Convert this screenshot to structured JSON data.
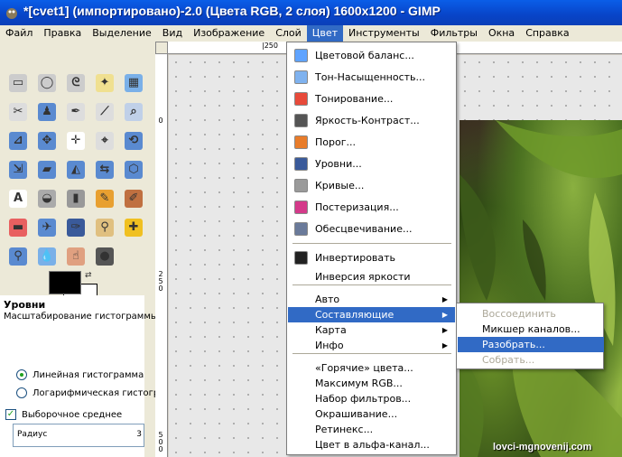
{
  "window": {
    "title": "*[cvet1] (импортировано)-2.0 (Цвета RGB, 2 слоя) 1600x1200 - GIMP"
  },
  "menubar": [
    {
      "label": "Файл",
      "active": false
    },
    {
      "label": "Правка",
      "active": false
    },
    {
      "label": "Выделение",
      "active": false
    },
    {
      "label": "Вид",
      "active": false
    },
    {
      "label": "Изображение",
      "active": false
    },
    {
      "label": "Слой",
      "active": false
    },
    {
      "label": "Цвет",
      "active": true
    },
    {
      "label": "Инструменты",
      "active": false
    },
    {
      "label": "Фильтры",
      "active": false
    },
    {
      "label": "Окна",
      "active": false
    },
    {
      "label": "Справка",
      "active": false
    }
  ],
  "color_menu": {
    "items": [
      {
        "label": "Цветовой баланс...",
        "icon": "color-balance-icon",
        "icon_color": "#5fa3ff"
      },
      {
        "label": "Тон-Насыщенность...",
        "icon": "hue-saturation-icon",
        "icon_color": "#7fb2ef"
      },
      {
        "label": "Тонирование...",
        "icon": "colorize-icon",
        "icon_color": "#e84a3a"
      },
      {
        "label": "Яркость-Контраст...",
        "icon": "brightness-contrast-icon",
        "icon_color": "#555555"
      },
      {
        "label": "Порог...",
        "icon": "threshold-icon",
        "icon_color": "#e87c2a"
      },
      {
        "label": "Уровни...",
        "icon": "levels-icon",
        "icon_color": "#3a5a9a"
      },
      {
        "label": "Кривые...",
        "icon": "curves-icon",
        "icon_color": "#9a9a9a"
      },
      {
        "label": "Постеризация...",
        "icon": "posterize-icon",
        "icon_color": "#d43a8a"
      },
      {
        "label": "Обесцвечивание...",
        "icon": "desaturate-icon",
        "icon_color": "#6a7a9a"
      },
      {
        "label": "Инвертировать",
        "icon": "invert-icon",
        "icon_color": "#222222"
      },
      {
        "label": "Инверсия яркости",
        "icon": "",
        "icon_color": ""
      },
      {
        "label": "Авто",
        "submenu": true
      },
      {
        "label": "Составляющие",
        "submenu": true,
        "highlighted": true
      },
      {
        "label": "Карта",
        "submenu": true
      },
      {
        "label": "Инфо",
        "submenu": true
      },
      {
        "label": "«Горячие» цвета..."
      },
      {
        "label": "Максимум RGB..."
      },
      {
        "label": "Набор фильтров..."
      },
      {
        "label": "Окрашивание..."
      },
      {
        "label": "Ретинекс..."
      },
      {
        "label": "Цвет в альфа-канал..."
      }
    ]
  },
  "components_submenu": {
    "items": [
      {
        "label": "Воссоединить",
        "disabled": true
      },
      {
        "label": "Микшер каналов...",
        "disabled": false
      },
      {
        "label": "Разобрать...",
        "disabled": false,
        "highlighted": true
      },
      {
        "label": "Собрать...",
        "disabled": true
      }
    ]
  },
  "toolbox": {
    "tools": [
      {
        "name": "rect-select-icon",
        "glyph": "▭",
        "color": "#cccccc"
      },
      {
        "name": "ellipse-select-icon",
        "glyph": "◯",
        "color": "#cccccc"
      },
      {
        "name": "free-select-icon",
        "glyph": "ᘓ",
        "color": "#cccccc"
      },
      {
        "name": "fuzzy-select-icon",
        "glyph": "✦",
        "color": "#f0e090"
      },
      {
        "name": "color-select-icon",
        "glyph": "▦",
        "color": "#7ab0e8"
      },
      {
        "name": "scissors-icon",
        "glyph": "✂",
        "color": "#dddddd"
      },
      {
        "name": "foreground-select-icon",
        "glyph": "♟",
        "color": "#5a8ad0"
      },
      {
        "name": "paths-icon",
        "glyph": "✒",
        "color": "#dddddd"
      },
      {
        "name": "color-picker-icon",
        "glyph": "⟋",
        "color": "#dddddd"
      },
      {
        "name": "zoom-icon",
        "glyph": "⌕",
        "color": "#c0d0e8"
      },
      {
        "name": "measure-icon",
        "glyph": "⊿",
        "color": "#5a8ad0"
      },
      {
        "name": "move-icon",
        "glyph": "✥",
        "color": "#5a8ad0"
      },
      {
        "name": "align-icon",
        "glyph": "✛",
        "color": "#ffffff"
      },
      {
        "name": "crop-icon",
        "glyph": "⌖",
        "color": "#dddddd"
      },
      {
        "name": "rotate-icon",
        "glyph": "⟲",
        "color": "#5a8ad0"
      },
      {
        "name": "scale-icon",
        "glyph": "⇲",
        "color": "#5a8ad0"
      },
      {
        "name": "shear-icon",
        "glyph": "▰",
        "color": "#5a8ad0"
      },
      {
        "name": "perspective-icon",
        "glyph": "◭",
        "color": "#5a8ad0"
      },
      {
        "name": "flip-icon",
        "glyph": "⇆",
        "color": "#5a8ad0"
      },
      {
        "name": "cage-icon",
        "glyph": "⬡",
        "color": "#5a8ad0"
      },
      {
        "name": "text-icon",
        "glyph": "A",
        "color": "#ffffff"
      },
      {
        "name": "bucket-fill-icon",
        "glyph": "◒",
        "color": "#aaaaaa"
      },
      {
        "name": "blend-icon",
        "glyph": "▮",
        "color": "#999999"
      },
      {
        "name": "pencil-icon",
        "glyph": "✎",
        "color": "#e8a030"
      },
      {
        "name": "paintbrush-icon",
        "glyph": "✐",
        "color": "#c07040"
      },
      {
        "name": "eraser-icon",
        "glyph": "▬",
        "color": "#e86060"
      },
      {
        "name": "airbrush-icon",
        "glyph": "✈",
        "color": "#5a8ad0"
      },
      {
        "name": "ink-icon",
        "glyph": "✑",
        "color": "#3a5a9a"
      },
      {
        "name": "clone-icon",
        "glyph": "⚲",
        "color": "#e0c080"
      },
      {
        "name": "heal-icon",
        "glyph": "✚",
        "color": "#f0c020"
      },
      {
        "name": "perspective-clone-icon",
        "glyph": "⚲",
        "color": "#5a8ad0"
      },
      {
        "name": "blur-icon",
        "glyph": "💧",
        "color": "#7ab0e8"
      },
      {
        "name": "smudge-icon",
        "glyph": "☝",
        "color": "#e0a080"
      },
      {
        "name": "dodge-burn-icon",
        "glyph": "●",
        "color": "#555555"
      }
    ]
  },
  "dock": {
    "tab_icon": "tool-options-icon",
    "title": "Уровни",
    "subtitle": "Масштабирование гистограммы",
    "linear_label": "Линейная гистограмма",
    "log_label": "Логарифмическая гистограм",
    "sample_average_label": "Выборочное среднее",
    "radius_label": "Радиус",
    "radius_value": "3"
  },
  "rulers": {
    "h_label": "|250",
    "v_labels": [
      "0",
      "250",
      "500"
    ]
  },
  "watermark": "lovci-mgnovenij.com"
}
